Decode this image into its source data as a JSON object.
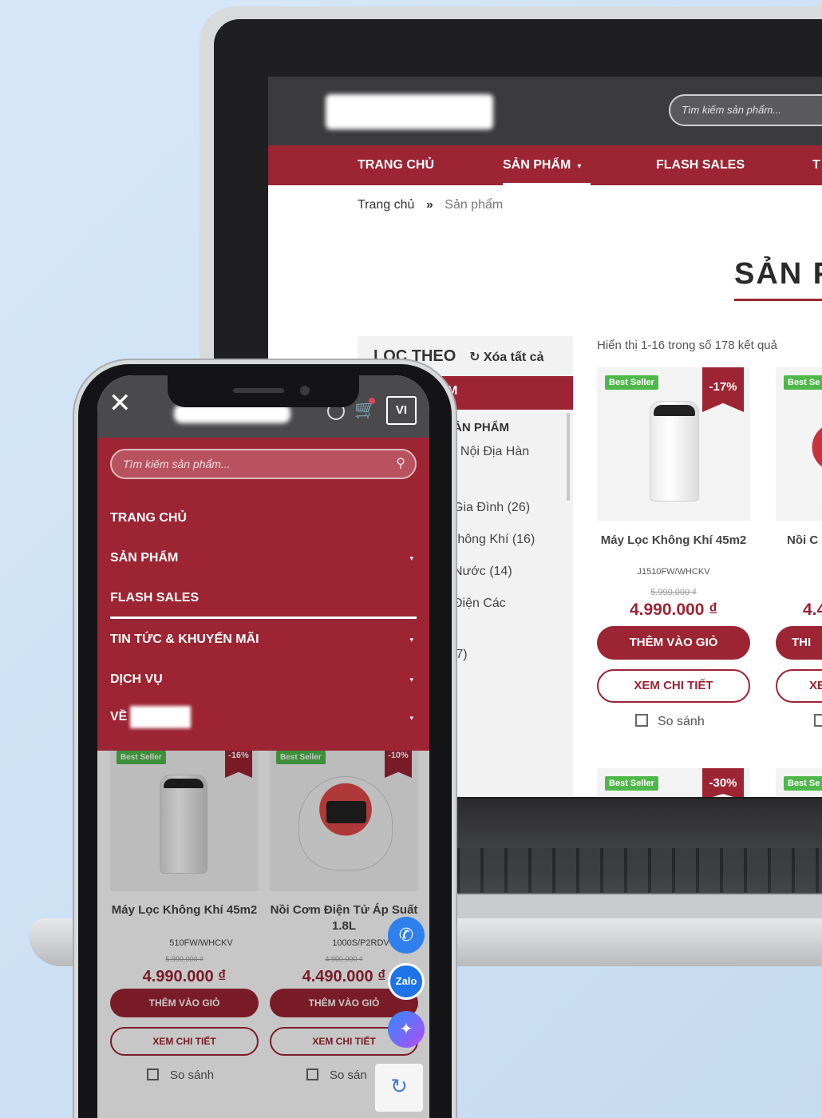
{
  "desktop": {
    "search_placeholder": "Tìm kiếm sản phẩm...",
    "nav": [
      {
        "label": "TRANG CHỦ"
      },
      {
        "label": "SẢN PHẨM"
      },
      {
        "label": "FLASH SALES"
      },
      {
        "label": "T"
      }
    ],
    "nav_caret": "▾",
    "breadcrumb": {
      "home": "Trang chủ",
      "separator": "»",
      "current": "Sản phẩm"
    },
    "page_title": "SẢN P",
    "filter": {
      "heading": "LỌC THEO",
      "clear_label": "Xóa tất cả",
      "clear_icon": "↻",
      "category_bar_text": "M",
      "subheading": "ẢN PHẨM",
      "categories": [
        "ı Nội Địa Hàn",
        "Gia Đình (26)",
        "ˈhông Khí (16)",
        "Nước (14)",
        "Điện Các",
        "(7)"
      ]
    },
    "results_text": "Hiển thị 1-16 trong số 178 kết quả",
    "products": [
      {
        "badge": "Best Seller",
        "discount": "-17%",
        "name": "Máy Lọc Không Khí 45m2",
        "sku": "J1510FW/WHCKV",
        "old_price": "5.990.000 ₫",
        "price": "4.990.000 ₫",
        "add_label": "THÊM VÀO GIỎ",
        "view_label": "XEM CHI TIẾT",
        "compare_label": "So sánh"
      },
      {
        "badge": "Best Se",
        "discount": "",
        "name": "Nồi C",
        "sku": "",
        "old_price": "",
        "price": "4.4",
        "add_label": "THI",
        "view_label": "XE",
        "compare_label": ""
      }
    ],
    "second_row": [
      {
        "badge": "Best Seller",
        "discount": "-30%"
      },
      {
        "badge": "Best Se"
      }
    ]
  },
  "mobile": {
    "close_icon": "✕",
    "cart_icon": "🛒",
    "lang": "VI",
    "search_placeholder": "Tìm kiếm sản phẩm...",
    "search_icon": "⚲",
    "menu": [
      {
        "label": "TRANG CHỦ",
        "has_arrow": false
      },
      {
        "label": "SẢN PHẨM",
        "has_arrow": true
      },
      {
        "label": "FLASH SALES",
        "has_arrow": false
      },
      {
        "label": "TIN TỨC & KHUYẾN MÃI",
        "has_arrow": true
      },
      {
        "label": "DỊCH VỤ",
        "has_arrow": true
      },
      {
        "label": "VỀ",
        "has_arrow": true
      }
    ],
    "menu_arrow": "▾",
    "products": [
      {
        "badge": "Best Seller",
        "discount": "-16%",
        "name": "Máy Lọc Không Khí 45m2",
        "sku": "510FW/WHCKV",
        "old_price": "5.990.000 ₫",
        "price": "4.990.000 ₫",
        "add_label": "THÊM VÀO GIỎ",
        "view_label": "XEM CHI TIẾT",
        "compare_label": "So sánh"
      },
      {
        "badge": "Best Seller",
        "discount": "-10%",
        "name": "Nồi Cơm Điện Tử Áp Suất 1.8L",
        "sku": "1000S/P2RDV",
        "old_price": "4.990.000 ₫",
        "price": "4.490.000 ₫",
        "add_label": "THÊM VÀO GIỎ",
        "view_label": "XEM CHI TIẾT",
        "compare_label": "So sán"
      }
    ],
    "floating": {
      "phone_icon": "✆",
      "zalo_label": "Zalo",
      "messenger_icon": "✦",
      "recaptcha_icon": "↻"
    }
  },
  "colors": {
    "brand": "#9c2433",
    "header_dark": "#3b3b3d",
    "badge_green": "#4fb84a"
  }
}
